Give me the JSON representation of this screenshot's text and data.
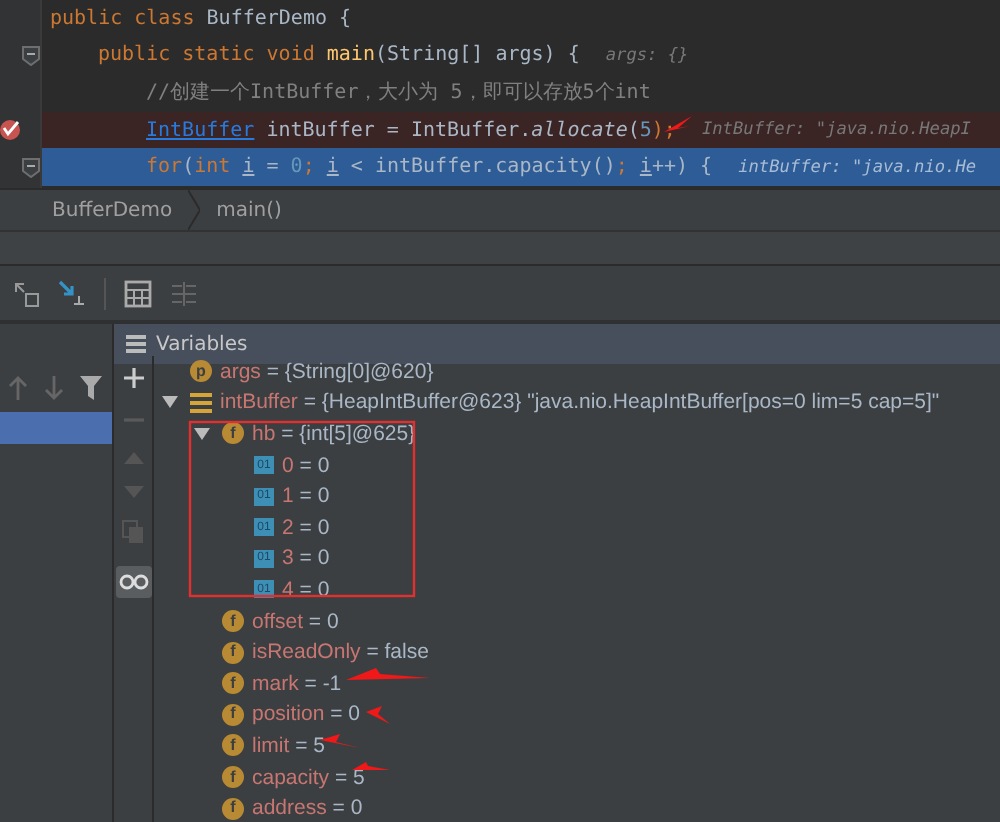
{
  "code_lines": [
    {
      "kind": "normal",
      "fold": false,
      "tokens": [
        {
          "t": "public class ",
          "kind": "kw"
        },
        {
          "t": "BufferDemo {",
          "kind": "plain"
        }
      ],
      "children": [
        {
          "kind": "normal",
          "fold": true,
          "tokens": [
            {
              "t": "public static void ",
              "kind": "kw"
            },
            {
              "t": "main",
              "kind": "method"
            },
            {
              "t": "(String[] args) {",
              "kind": "plain"
            }
          ],
          "hint": "args: {}",
          "children": [
            {
              "kind": "normal",
              "fold": false,
              "tokens": [
                {
                  "t": "//创建一个IntBuffer，大小为 5，即可以存放5个int",
                  "kind": "comment"
                }
              ]
            },
            {
              "kind": "breakpoint",
              "fold": false,
              "tokens": [
                {
                  "t": "IntBuffer",
                  "kind": "link"
                },
                {
                  "t": " intBuffer = IntBuffer.",
                  "kind": "plain"
                },
                {
                  "t": "allocate",
                  "kind": "static"
                },
                {
                  "t": "(",
                  "kind": "plain"
                },
                {
                  "t": "5",
                  "kind": "number"
                },
                {
                  "t": ");",
                  "kind": "punct"
                }
              ],
              "hint": "IntBuffer: \"java.nio.HeapI"
            },
            {
              "kind": "current",
              "fold": true,
              "tokens": [
                {
                  "t": "for",
                  "kind": "kw"
                },
                {
                  "t": "(",
                  "kind": "plain"
                },
                {
                  "t": "int ",
                  "kind": "kw"
                },
                {
                  "t": "i",
                  "kind": "var"
                },
                {
                  "t": " = ",
                  "kind": "plain"
                },
                {
                  "t": "0",
                  "kind": "number"
                },
                {
                  "t": "; ",
                  "kind": "punct"
                },
                {
                  "t": "i",
                  "kind": "var"
                },
                {
                  "t": " < intBuffer.capacity()",
                  "kind": "plain"
                },
                {
                  "t": "; ",
                  "kind": "punct"
                },
                {
                  "t": "i",
                  "kind": "var"
                },
                {
                  "t": "++) {",
                  "kind": "plain"
                }
              ],
              "hint": "intBuffer: \"java.nio.He"
            }
          ]
        }
      ]
    }
  ],
  "breadcrumbs": [
    "BufferDemo",
    "main()"
  ],
  "variables_title": "Variables",
  "variables": [
    {
      "icon": {
        "kind": "param",
        "glyph": "p"
      },
      "name": "args",
      "sep": "=",
      "value": "{String[0]@620}"
    },
    {
      "icon": {
        "kind": "object"
      },
      "name": "intBuffer",
      "sep": "=",
      "value": "{HeapIntBuffer@623} \"java.nio.HeapIntBuffer[pos=0 lim=5 cap=5]\"",
      "expanded": true,
      "children": [
        {
          "icon": {
            "kind": "field",
            "glyph": "f"
          },
          "name": "hb",
          "sep": "=",
          "value": "{int[5]@625}",
          "expanded": true,
          "children": [
            {
              "icon": {
                "kind": "element",
                "glyph": "01"
              },
              "name": "0",
              "sep": "=",
              "value": "0"
            },
            {
              "icon": {
                "kind": "element",
                "glyph": "01"
              },
              "name": "1",
              "sep": "=",
              "value": "0"
            },
            {
              "icon": {
                "kind": "element",
                "glyph": "01"
              },
              "name": "2",
              "sep": "=",
              "value": "0"
            },
            {
              "icon": {
                "kind": "element",
                "glyph": "01"
              },
              "name": "3",
              "sep": "=",
              "value": "0"
            },
            {
              "icon": {
                "kind": "element",
                "glyph": "01"
              },
              "name": "4",
              "sep": "=",
              "value": "0"
            }
          ]
        },
        {
          "icon": {
            "kind": "field",
            "glyph": "f"
          },
          "name": "offset",
          "sep": "=",
          "value": "0"
        },
        {
          "icon": {
            "kind": "field",
            "glyph": "f"
          },
          "name": "isReadOnly",
          "sep": "=",
          "value": "false"
        },
        {
          "icon": {
            "kind": "field",
            "glyph": "f"
          },
          "name": "mark",
          "sep": "=",
          "value": "-1"
        },
        {
          "icon": {
            "kind": "field",
            "glyph": "f"
          },
          "name": "position",
          "sep": "=",
          "value": "0"
        },
        {
          "icon": {
            "kind": "field",
            "glyph": "f"
          },
          "name": "limit",
          "sep": "=",
          "value": "5"
        },
        {
          "icon": {
            "kind": "field",
            "glyph": "f"
          },
          "name": "capacity",
          "sep": "=",
          "value": "5"
        },
        {
          "icon": {
            "kind": "field",
            "glyph": "f"
          },
          "name": "address",
          "sep": "=",
          "value": "0"
        }
      ]
    }
  ]
}
